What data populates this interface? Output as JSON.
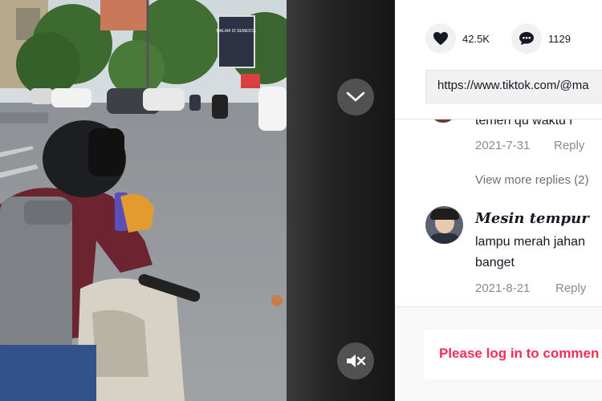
{
  "video": {
    "billboard_text": "MALAM DI SEMESTA",
    "collapse_icon": "chevron-down-icon",
    "mute_icon": "volume-mute-icon"
  },
  "stats": {
    "likes": "42.5K",
    "comments": "1129",
    "like_icon": "heart-icon",
    "comment_icon": "comment-icon"
  },
  "share": {
    "url": "https://www.tiktok.com/@ma"
  },
  "comments": {
    "partial_text": "temen qu waktu r",
    "partial_date": "2021-7-31",
    "partial_reply": "Reply",
    "view_more": "View more replies (2)",
    "item": {
      "username": "Mesin tempur",
      "text_line1": "lampu merah jahan",
      "text_line2": "banget",
      "date": "2021-8-21",
      "reply": "Reply"
    }
  },
  "footer": {
    "login_prompt": "Please log in to commen"
  },
  "colors": {
    "accent": "#fe2c55",
    "muted": "#8a8b91",
    "text": "#161823"
  }
}
